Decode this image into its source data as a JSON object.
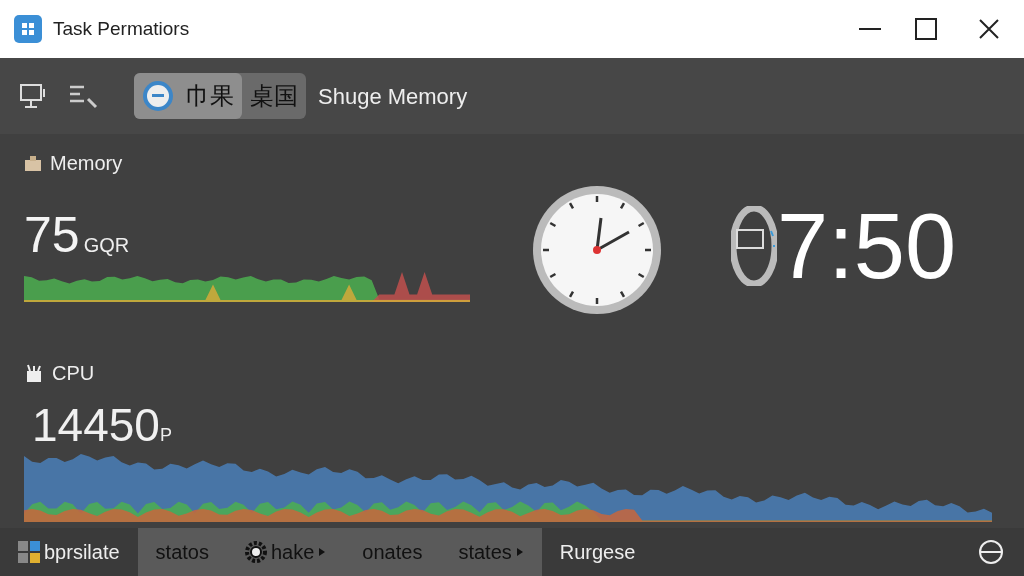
{
  "window": {
    "title": "Task Permatiors"
  },
  "tabs": [
    {
      "label": "巾果",
      "selected": true
    },
    {
      "label": "桌国",
      "selected": false
    }
  ],
  "toolbar_label": "Shuge Memory",
  "memory": {
    "title": "Memory",
    "reading": "75",
    "unit": "GQR"
  },
  "clock": {
    "time": "7:50"
  },
  "cpu": {
    "title": "CPU",
    "reading": "14450",
    "unit": "P"
  },
  "status_bar": [
    {
      "label": "bprsilate",
      "kind": "grid",
      "selected": false
    },
    {
      "label": "statos",
      "kind": "plain",
      "selected": true
    },
    {
      "label": "hake",
      "kind": "gear",
      "selected": true
    },
    {
      "label": "onates",
      "kind": "plain",
      "selected": true
    },
    {
      "label": "states",
      "kind": "arrow",
      "selected": true
    },
    {
      "label": "Rurgese",
      "kind": "plain",
      "selected": false
    }
  ]
}
